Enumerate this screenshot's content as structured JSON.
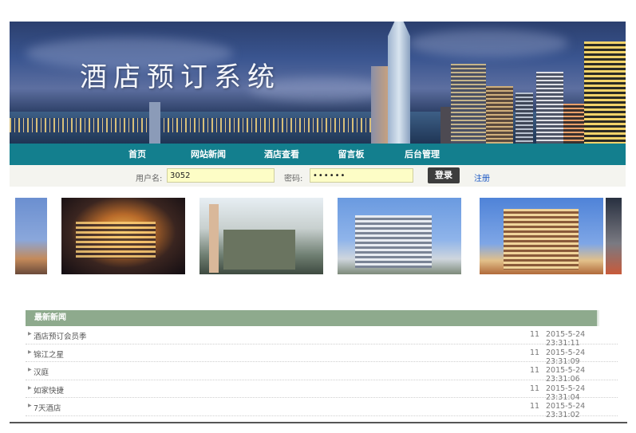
{
  "banner": {
    "title": "酒店预订系统"
  },
  "nav": {
    "items": [
      {
        "label": "首页"
      },
      {
        "label": "网站新闻"
      },
      {
        "label": "酒店查看"
      },
      {
        "label": "留言板"
      },
      {
        "label": "后台管理"
      }
    ]
  },
  "login": {
    "username_label": "用户名:",
    "username_value": "3052",
    "password_label": "密码:",
    "password_value": "••••••",
    "login_button": "登录",
    "register_link": "注册"
  },
  "news": {
    "header": "最新新闻",
    "items": [
      {
        "title": "酒店预订会员季",
        "count": "11",
        "date": "2015-5-24 23:31:11"
      },
      {
        "title": "锦江之星",
        "count": "11",
        "date": "2015-5-24 23:31:09"
      },
      {
        "title": "汉庭",
        "count": "11",
        "date": "2015-5-24 23:31:06"
      },
      {
        "title": "如家快捷",
        "count": "11",
        "date": "2015-5-24 23:31:04"
      },
      {
        "title": "7天酒店",
        "count": "11",
        "date": "2015-5-24 23:31:02"
      }
    ]
  },
  "colors": {
    "nav": "#137f8e",
    "news_header": "#8eaa8d",
    "login_bar": "#f4f4ef",
    "link": "#1a57c4"
  }
}
